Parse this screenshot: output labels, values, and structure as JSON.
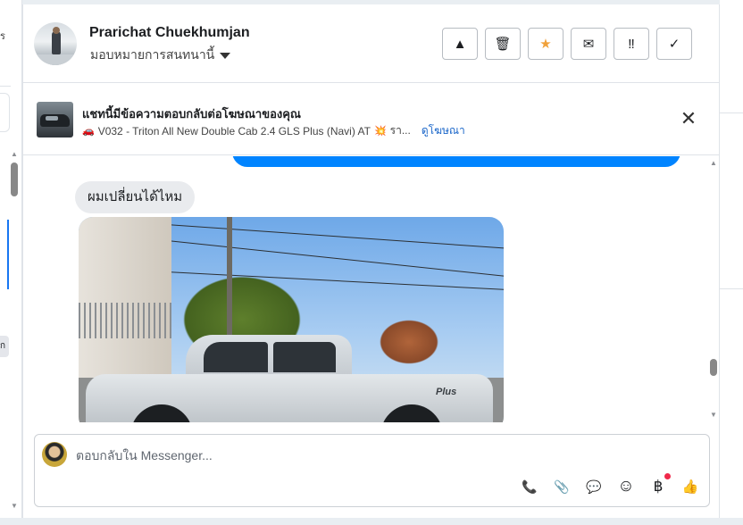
{
  "left_pane": {
    "fragments": [
      "ร",
      "ก"
    ]
  },
  "header": {
    "contact_name": "Prarichat Chuekhumjan",
    "assign_label": "มอบหมายการสนทนานี้",
    "actions": [
      {
        "name": "warning",
        "glyph": "▲"
      },
      {
        "name": "trash",
        "glyph": "🗑"
      },
      {
        "name": "star",
        "glyph": "★"
      },
      {
        "name": "envelope",
        "glyph": "✉"
      },
      {
        "name": "follow-up",
        "glyph": "‼"
      },
      {
        "name": "done",
        "glyph": "✓"
      }
    ]
  },
  "ad": {
    "title": "แชทนี้มีข้อความตอบกลับต่อโฆษณาของคุณ",
    "truck_emoji": "🚗",
    "listing": "V032 - Triton All New Double Cab 2.4 GLS Plus (Navi) AT",
    "spark_emoji": "💥",
    "trail": "รา...",
    "link": "ดูโฆษณา",
    "close_glyph": "✕"
  },
  "thread": {
    "received_message": "ผมเปลี่ยนได้ไหม",
    "photo_badge": "Plus"
  },
  "composer": {
    "placeholder": "ตอบกลับใน Messenger...",
    "tools": [
      {
        "name": "call-add",
        "glyph": "📞"
      },
      {
        "name": "attachment",
        "glyph": "📎"
      },
      {
        "name": "saved-replies",
        "glyph": "💬"
      },
      {
        "name": "emoji",
        "glyph": "☺"
      },
      {
        "name": "currency",
        "glyph": "฿"
      },
      {
        "name": "like",
        "glyph": "👍"
      }
    ]
  },
  "colors": {
    "accent": "#0084ff",
    "star": "#f0a13a",
    "link": "#1a66c9",
    "notification_dot": "#f0284a"
  }
}
